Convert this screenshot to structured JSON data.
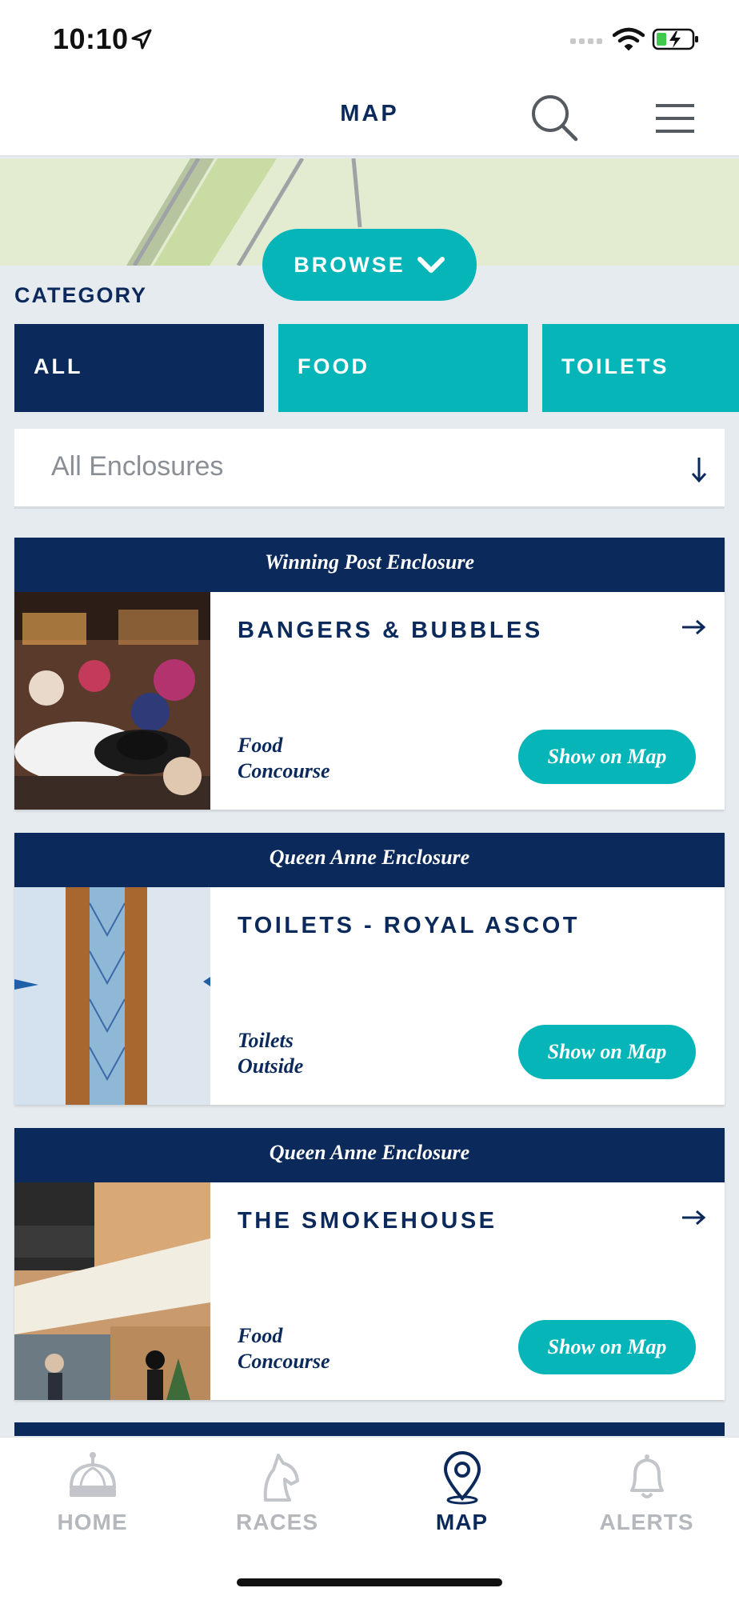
{
  "status": {
    "time": "10:10"
  },
  "header": {
    "title": "MAP"
  },
  "browse": {
    "label": "BROWSE"
  },
  "category": {
    "label": "CATEGORY",
    "items": [
      {
        "label": "ALL",
        "active": true
      },
      {
        "label": "FOOD",
        "active": false
      },
      {
        "label": "TOILETS",
        "active": false
      }
    ]
  },
  "enclosure_select": {
    "value": "All Enclosures"
  },
  "venues": [
    {
      "enclosure": "Winning Post Enclosure",
      "name": "BANGERS & BUBBLES",
      "type": "Food",
      "location": "Concourse",
      "button": "Show on Map"
    },
    {
      "enclosure": "Queen Anne Enclosure",
      "name": "TOILETS - ROYAL ASCOT",
      "type": "Toilets",
      "location": "Outside",
      "button": "Show on Map"
    },
    {
      "enclosure": "Queen Anne Enclosure",
      "name": "THE SMOKEHOUSE",
      "type": "Food",
      "location": "Concourse",
      "button": "Show on Map"
    }
  ],
  "tabs": [
    {
      "label": "HOME",
      "icon": "crown-icon"
    },
    {
      "label": "RACES",
      "icon": "horse-head-icon"
    },
    {
      "label": "MAP",
      "icon": "map-pin-icon"
    },
    {
      "label": "ALERTS",
      "icon": "bell-icon"
    }
  ],
  "colors": {
    "navy": "#0b2a5b",
    "teal": "#06b5b8",
    "background": "#e6ebef"
  }
}
